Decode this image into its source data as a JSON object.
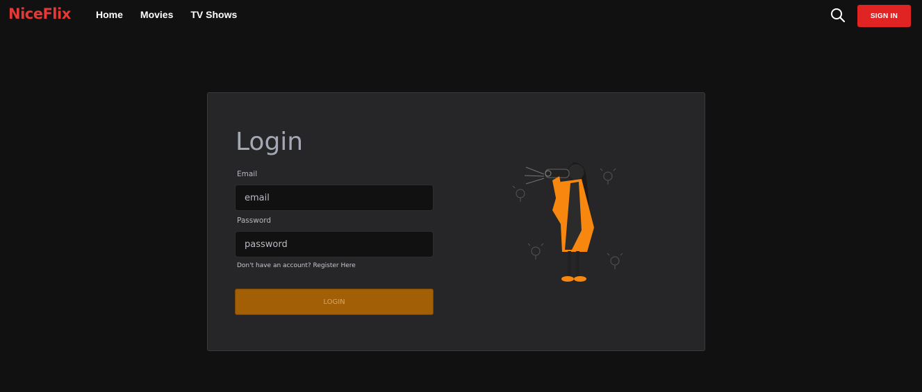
{
  "brand": {
    "name": "NiceFlix",
    "color": "#e53935"
  },
  "nav": {
    "items": [
      "Home",
      "Movies",
      "TV Shows"
    ]
  },
  "header": {
    "search_icon": "search-icon",
    "signin_label": "SIGN IN",
    "accent": "#e02424"
  },
  "login": {
    "title": "Login",
    "email_label": "Email",
    "email_placeholder": "email",
    "password_label": "Password",
    "password_placeholder": "password",
    "register_text": "Don't have an account? ",
    "register_link": "Register Here",
    "button_label": "LOGIN",
    "button_color": "#a35f05"
  },
  "illustration": {
    "name": "person-with-binoculars-illustration",
    "accent": "#f7870f"
  }
}
